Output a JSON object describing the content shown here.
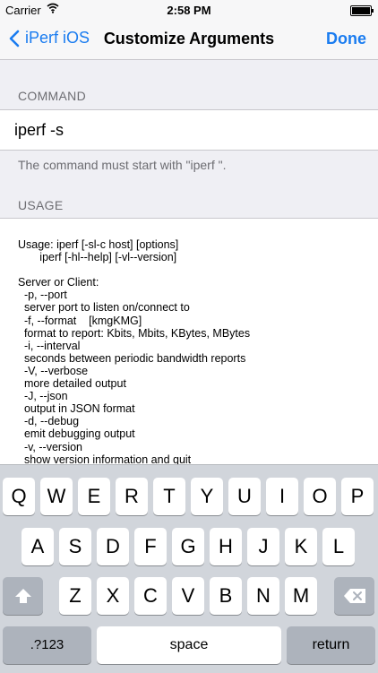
{
  "status_bar": {
    "carrier": "Carrier",
    "time": "2:58 PM",
    "icons": [
      "wifi-icon",
      "battery-icon"
    ]
  },
  "nav": {
    "back_label": "iPerf iOS",
    "title": "Customize Arguments",
    "done_label": "Done"
  },
  "command_section": {
    "header": "COMMAND",
    "value": "iperf -s",
    "footer": "The command must start with \"iperf \"."
  },
  "usage_section": {
    "header": "USAGE",
    "text": "Usage: iperf [-sl-c host] [options]\n       iperf [-hl--help] [-vl--version]\n\nServer or Client:\n  -p, --port\n  server port to listen on/connect to\n  -f, --format    [kmgKMG]\n  format to report: Kbits, Mbits, KBytes, MBytes\n  -i, --interval\n  seconds between periodic bandwidth reports\n  -V, --verbose\n  more detailed output\n  -J, --json\n  output in JSON format\n  -d, --debug\n  emit debugging output\n  -v, --version\n  show version information and quit"
  },
  "keyboard": {
    "row1": [
      "Q",
      "W",
      "E",
      "R",
      "T",
      "Y",
      "U",
      "I",
      "O",
      "P"
    ],
    "row2": [
      "A",
      "S",
      "D",
      "F",
      "G",
      "H",
      "J",
      "K",
      "L"
    ],
    "row3": [
      "Z",
      "X",
      "C",
      "V",
      "B",
      "N",
      "M"
    ],
    "numbers_label": ".?123",
    "space_label": "space",
    "return_label": "return",
    "icons": [
      "shift-icon",
      "backspace-icon"
    ]
  },
  "colors": {
    "accent": "#1a7cf0",
    "background": "#efeff4",
    "keyboard_bg": "#d1d5db"
  }
}
